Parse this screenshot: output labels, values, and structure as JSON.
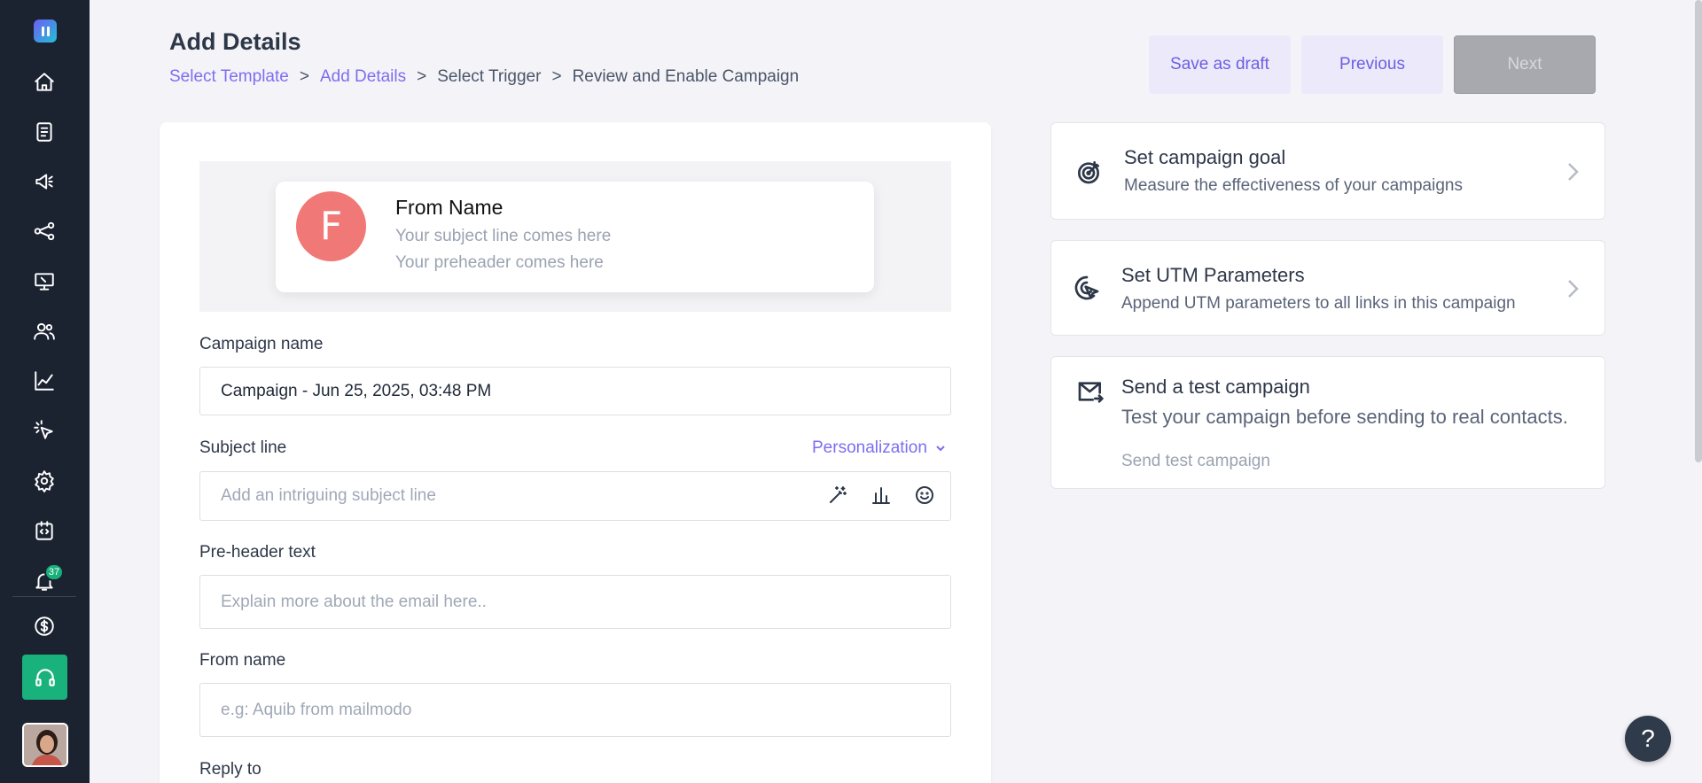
{
  "sidebar": {
    "notification_count": "37",
    "icons": [
      "home-icon",
      "document-icon",
      "megaphone-icon",
      "share-icon",
      "screen-icon",
      "users-icon",
      "chart-line-icon",
      "cursor-click-icon",
      "gear-icon",
      "code-icon",
      "bell-icon",
      "dollar-icon",
      "headset-icon"
    ]
  },
  "header": {
    "title": "Add Details",
    "breadcrumb": [
      "Select Template",
      "Add Details",
      "Select Trigger",
      "Review and Enable Campaign"
    ],
    "separator": ">",
    "buttons": {
      "save_draft": "Save as draft",
      "previous": "Previous",
      "next": "Next"
    }
  },
  "preview": {
    "avatar_letter": "F",
    "from_name": "From Name",
    "subject_placeholder": "Your subject line comes here",
    "preheader_placeholder": "Your preheader comes here"
  },
  "form": {
    "campaign_name_label": "Campaign name",
    "campaign_name_value": "Campaign - Jun 25, 2025, 03:48 PM",
    "subject_label": "Subject line",
    "personalization": "Personalization",
    "subject_placeholder": "Add an intriguing subject line",
    "preheader_label": "Pre-header text",
    "preheader_placeholder": "Explain more about the email here..",
    "from_name_label": "From name",
    "from_name_placeholder": "e.g: Aquib from mailmodo",
    "reply_to_label": "Reply to"
  },
  "panels": {
    "goal": {
      "title": "Set campaign goal",
      "desc": "Measure the effectiveness of your campaigns"
    },
    "utm": {
      "title": "Set UTM Parameters",
      "desc": "Append UTM parameters to all links in this campaign"
    },
    "test": {
      "title": "Send a test campaign",
      "desc": "Test your campaign before sending to real contacts.",
      "link": "Send test campaign"
    }
  },
  "help": "?",
  "colors": {
    "accent": "#7c6ef0",
    "sidebar": "#1b2230",
    "support": "#19b17c",
    "avatar": "#f07977"
  }
}
